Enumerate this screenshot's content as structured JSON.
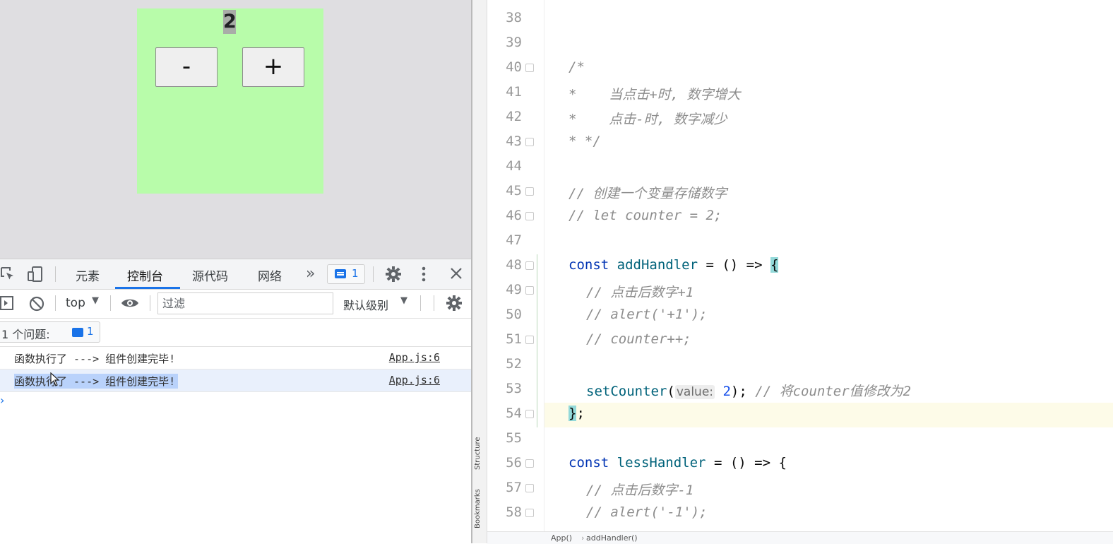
{
  "app": {
    "counter_value": "2",
    "minus_label": "-",
    "plus_label": "+"
  },
  "devtools": {
    "tabs": [
      "元素",
      "控制台",
      "源代码",
      "网络"
    ],
    "more_tabs": "»",
    "issues_count": "1",
    "context": "top",
    "filter_placeholder": "过滤",
    "level": "默认级别",
    "issues_label": "1 个问题:",
    "issues_chip_count": "1",
    "logs": [
      {
        "message": "函数执行了 ---> 组件创建完毕!",
        "source": "App.js:6"
      },
      {
        "message": "函数执行了 ---> 组件创建完毕!",
        "source": "App.js:6"
      }
    ],
    "prompt": "›",
    "accent_color": "#1a73e8"
  },
  "editor": {
    "side_labels": [
      "Structure",
      "Bookmarks"
    ],
    "lines": [
      {
        "n": "38"
      },
      {
        "n": "39"
      },
      {
        "n": "40"
      },
      {
        "n": "41"
      },
      {
        "n": "42"
      },
      {
        "n": "43"
      },
      {
        "n": "44"
      },
      {
        "n": "45"
      },
      {
        "n": "46"
      },
      {
        "n": "47"
      },
      {
        "n": "48"
      },
      {
        "n": "49"
      },
      {
        "n": "50"
      },
      {
        "n": "51"
      },
      {
        "n": "52"
      },
      {
        "n": "53"
      },
      {
        "n": "54"
      },
      {
        "n": "55"
      },
      {
        "n": "56"
      },
      {
        "n": "57"
      },
      {
        "n": "58"
      }
    ],
    "code": {
      "l40": "/*",
      "l41": "*    当点击+时, 数字增大",
      "l42": "*    点击-时, 数字减少",
      "l43": "* */",
      "l45": "// 创建一个变量存储数字",
      "l46": "// let counter = 2;",
      "l48_kw": "const",
      "l48_fn": "addHandler",
      "l48_rest": " = () => ",
      "l48_brace": "{",
      "l49": "// 点击后数字+1",
      "l50": "// alert('+1');",
      "l51": "// counter++;",
      "l53_fn": "setCounter",
      "l53_open": "(",
      "l53_hint": "value:",
      "l53_num": "2",
      "l53_close": ");",
      "l53_comment": "// 将counter值修改为2",
      "l54_brace": "}",
      "l54_rest": ";",
      "l56_kw": "const",
      "l56_fn": "lessHandler",
      "l56_rest": " = () => {",
      "l57": "// 点击后数字-1",
      "l58": "// alert('-1');"
    },
    "breadcrumb": [
      "App()",
      "addHandler()"
    ],
    "current_line_color": "#fdfbe8",
    "brace_match_color": "#93d9d9"
  }
}
